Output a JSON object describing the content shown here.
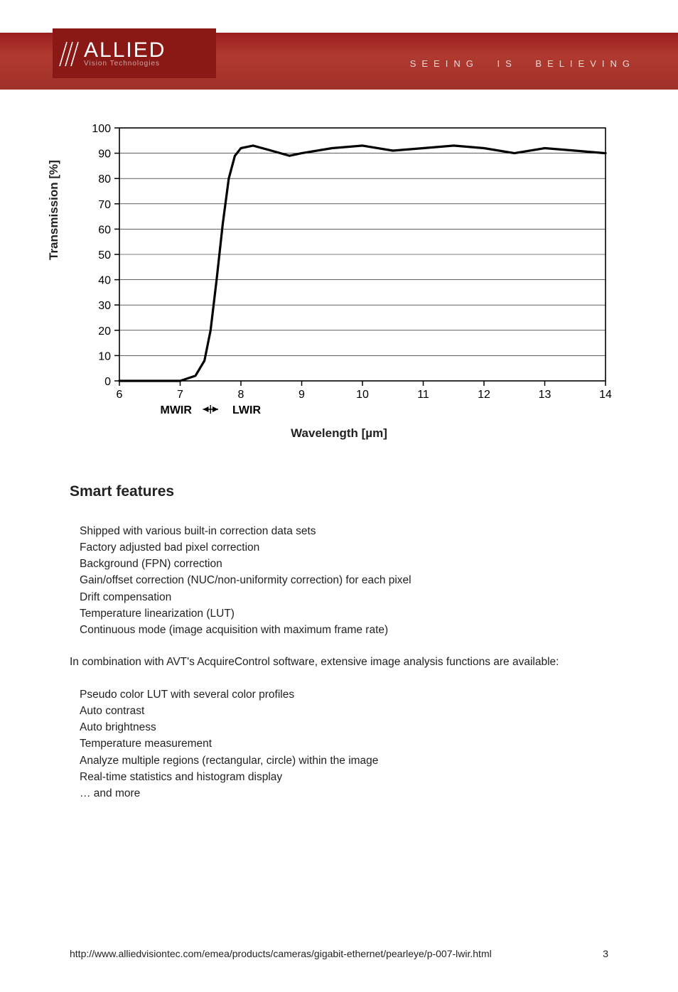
{
  "header": {
    "brand_top": "ALLIED",
    "brand_sub": "Vision Technologies",
    "tagline": "SEEING IS BELIEVING"
  },
  "chart_data": {
    "type": "line",
    "ylabel": "Transmission [%]",
    "xlabel": "Wavelength [µm]",
    "sub_left": "MWIR",
    "sub_right": "LWIR",
    "xlim": [
      6,
      14
    ],
    "ylim": [
      0,
      100
    ],
    "xticks": [
      6,
      7,
      8,
      9,
      10,
      11,
      12,
      13,
      14
    ],
    "yticks": [
      0,
      10,
      20,
      30,
      40,
      50,
      60,
      70,
      80,
      90,
      100
    ],
    "x": [
      6.0,
      6.5,
      7.0,
      7.25,
      7.4,
      7.5,
      7.6,
      7.7,
      7.8,
      7.9,
      8.0,
      8.2,
      8.5,
      8.8,
      9.0,
      9.5,
      10.0,
      10.5,
      11.0,
      11.5,
      12.0,
      12.5,
      13.0,
      13.5,
      14.0
    ],
    "y": [
      0,
      0,
      0,
      2,
      8,
      20,
      40,
      62,
      80,
      89,
      92,
      93,
      91,
      89,
      90,
      92,
      93,
      91,
      92,
      93,
      92,
      90,
      92,
      91,
      90
    ]
  },
  "body": {
    "heading": "Smart features",
    "list1": [
      "Shipped with various built-in correction data sets",
      "Factory adjusted bad pixel correction",
      "Background (FPN) correction",
      "Gain/offset correction (NUC/non-uniformity correction) for each pixel",
      "Drift compensation",
      "Temperature linearization (LUT)",
      "Continuous mode (image acquisition with maximum frame rate)"
    ],
    "intro": "In combination with AVT's AcquireControl software, extensive image analysis functions are available:",
    "list2": [
      "Pseudo color LUT with several color profiles",
      "Auto contrast",
      "Auto brightness",
      "Temperature measurement",
      "Analyze multiple regions (rectangular, circle) within the image",
      "Real-time statistics and histogram display",
      "… and more"
    ]
  },
  "footer": {
    "url": "http://www.alliedvisiontec.com/emea/products/cameras/gigabit-ethernet/pearleye/p-007-lwir.html",
    "page": "3"
  }
}
